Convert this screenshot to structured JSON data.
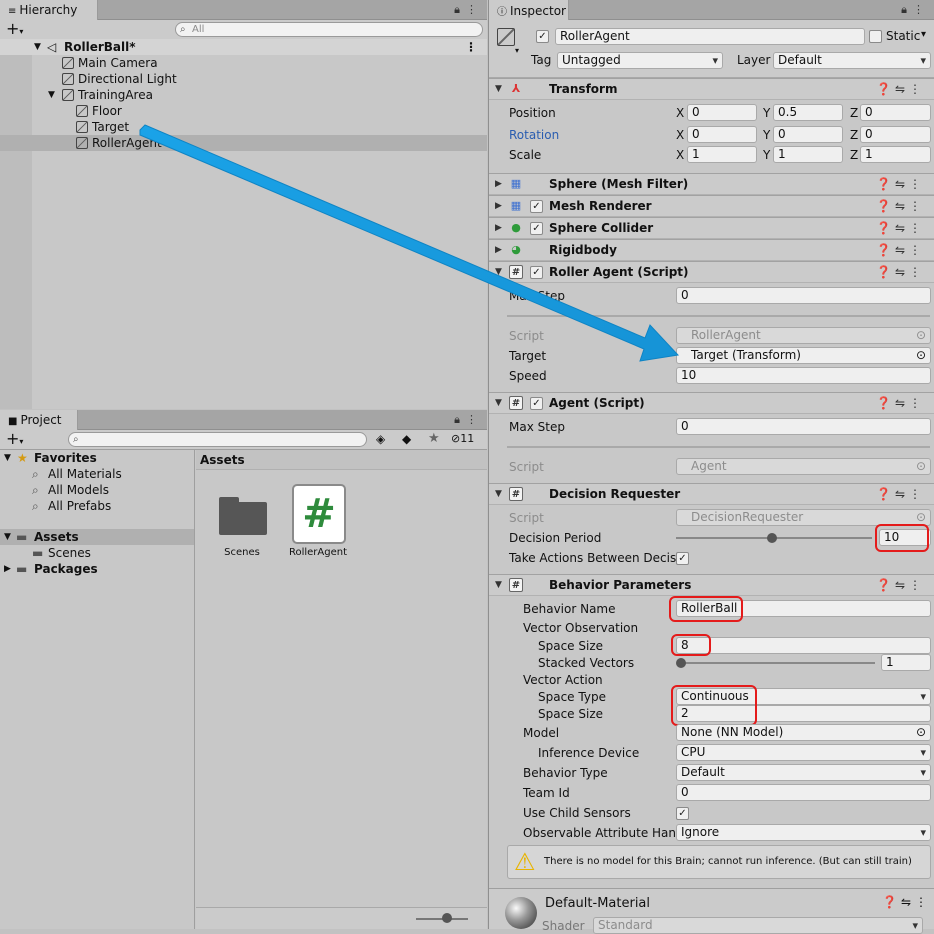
{
  "hierarchy": {
    "tab": "Hierarchy",
    "search_placeholder": "All",
    "scene": "RollerBall*",
    "items": [
      {
        "label": "Main Camera"
      },
      {
        "label": "Directional Light"
      },
      {
        "label": "TrainingArea"
      },
      {
        "label": "Floor"
      },
      {
        "label": "Target"
      },
      {
        "label": "RollerAgent"
      }
    ]
  },
  "project": {
    "tab": "Project",
    "hidden_count": "11",
    "favorites": "Favorites",
    "fav_items": [
      "All Materials",
      "All Models",
      "All Prefabs"
    ],
    "assets": "Assets",
    "scenes": "Scenes",
    "packages": "Packages",
    "assets_header": "Assets",
    "grid": [
      {
        "label": "Scenes",
        "icon": "folder-icon"
      },
      {
        "label": "RollerAgent",
        "icon": "script-hash-icon"
      }
    ]
  },
  "inspector": {
    "tab": "Inspector",
    "object_name": "RollerAgent",
    "static_label": "Static",
    "tag_label": "Tag",
    "tag_value": "Untagged",
    "layer_label": "Layer",
    "layer_value": "Default",
    "transform": {
      "title": "Transform",
      "position_label": "Position",
      "rotation_label": "Rotation",
      "scale_label": "Scale",
      "x": "X",
      "y": "Y",
      "z": "Z",
      "position": [
        "0",
        "0.5",
        "0"
      ],
      "rotation": [
        "0",
        "0",
        "0"
      ],
      "scale": [
        "1",
        "1",
        "1"
      ]
    },
    "components": {
      "mesh_filter": "Sphere (Mesh Filter)",
      "mesh_renderer": "Mesh Renderer",
      "sphere_collider": "Sphere Collider",
      "rigidbody": "Rigidbody"
    },
    "roller_agent": {
      "title": "Roller Agent (Script)",
      "max_step_label": "Max Step",
      "max_step": "0",
      "script_label": "Script",
      "script": "RollerAgent",
      "target_label": "Target",
      "target": "Target (Transform)",
      "speed_label": "Speed",
      "speed": "10"
    },
    "agent": {
      "title": "Agent (Script)",
      "max_step_label": "Max Step",
      "max_step": "0",
      "script_label": "Script",
      "script": "Agent"
    },
    "decision": {
      "title": "Decision Requester",
      "script_label": "Script",
      "script": "DecisionRequester",
      "period_label": "Decision Period",
      "period": "10",
      "take_actions_label": "Take Actions Between Decisi"
    },
    "behavior": {
      "title": "Behavior Parameters",
      "name_label": "Behavior Name",
      "name": "RollerBall",
      "vector_obs": "Vector Observation",
      "space_size_label": "Space Size",
      "obs_space_size": "8",
      "stacked_label": "Stacked Vectors",
      "stacked": "1",
      "vector_action": "Vector Action",
      "space_type_label": "Space Type",
      "space_type": "Continuous",
      "action_space_size": "2",
      "model_label": "Model",
      "model": "None (NN Model)",
      "inference_label": "Inference Device",
      "inference": "CPU",
      "behavior_type_label": "Behavior Type",
      "behavior_type": "Default",
      "team_label": "Team Id",
      "team": "0",
      "child_sensors_label": "Use Child Sensors",
      "observable_label": "Observable Attribute Handl",
      "observable": "Ignore",
      "warning": "There is no model for this Brain; cannot run inference. (But can still train)"
    },
    "material": {
      "name": "Default-Material",
      "shader_label": "Shader",
      "shader": "Standard"
    }
  },
  "colors": {
    "arrow": "#1aa3e8",
    "highlight": "#e41b1b",
    "selection": "#b0b0b0",
    "rotation_label": "#2a5db0"
  }
}
